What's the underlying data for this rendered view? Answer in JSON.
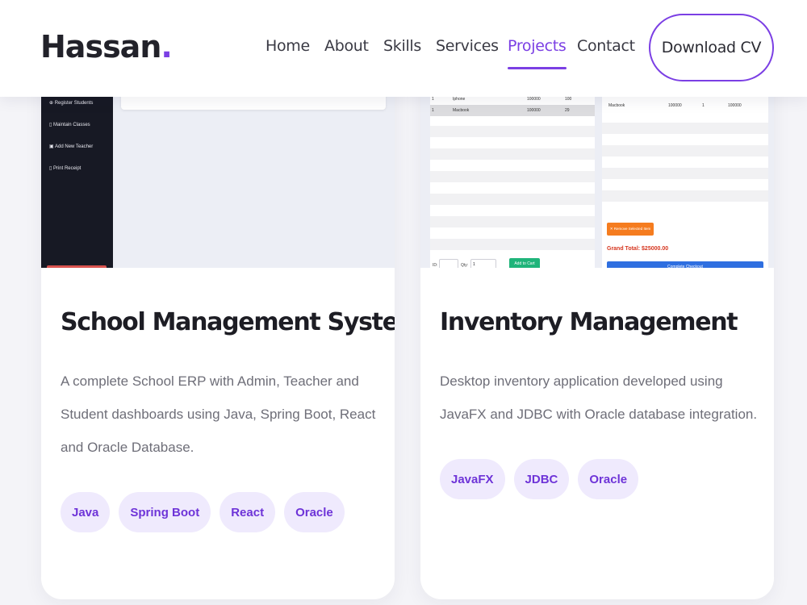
{
  "header": {
    "logo_text": "Hassan",
    "logo_dot": ".",
    "nav": [
      "Home",
      "About",
      "Skills",
      "Services",
      "Projects",
      "Contact"
    ],
    "active_nav": "Projects",
    "cv_button": "Download CV"
  },
  "colors": {
    "accent": "#7b3fe4",
    "tag_bg": "#efeafd",
    "tag_text": "#6e34d8"
  },
  "projects": [
    {
      "title": "School Management System",
      "description": "A complete School ERP with Admin, Teacher and Student dashboards using Java, Spring Boot, React and Oracle Database.",
      "tags": [
        "Java",
        "Spring Boot",
        "React",
        "Oracle"
      ],
      "thumbnail": {
        "sidebar_items": [
          "Register Students",
          "Maintain Classes",
          "Add New Teacher",
          "Print Receipt"
        ]
      }
    },
    {
      "title": "Inventory Management",
      "description": "Desktop inventory application developed using JavaFX and JDBC with Oracle database integration.",
      "tags": [
        "JavaFX",
        "JDBC",
        "Oracle"
      ],
      "thumbnail": {
        "left_rows": [
          [
            "1",
            "Iphone",
            "100000",
            "100"
          ],
          [
            "1",
            "Macbook",
            "100000",
            "29"
          ]
        ],
        "right_rows": [
          [
            "Macbook",
            "100000",
            "1",
            "100000"
          ]
        ],
        "remove_button": "Remove Selected Item",
        "grand_total": "Grand Total: $25000.00",
        "checkout_button": "Complete Checkout",
        "id_label": "ID:",
        "qty_label": "Qty:",
        "qty_value": "1",
        "add_button": "Add to Cart"
      }
    }
  ]
}
